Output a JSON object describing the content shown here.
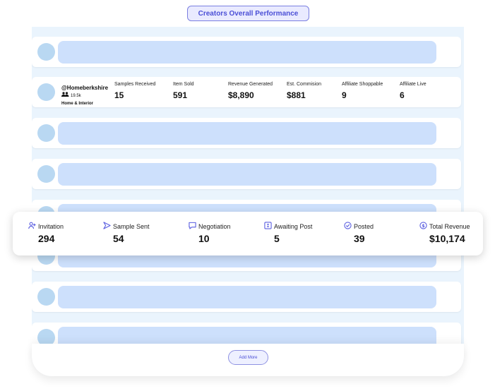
{
  "header": {
    "title": "Creators Overall Performance"
  },
  "creator": {
    "handle": "@Homeberkshire",
    "followers": "19.5k",
    "category": "Home & Interior"
  },
  "metrics": [
    {
      "label": "Samples Received",
      "value": "15"
    },
    {
      "label": "Item Sold",
      "value": "591"
    },
    {
      "label": "Revenue Generated",
      "value": "$8,890"
    },
    {
      "label": "Est. Commision",
      "value": "$881"
    },
    {
      "label": "Affiliate Shoppable",
      "value": "9"
    },
    {
      "label": "Affiliate Live",
      "value": "6"
    }
  ],
  "stats": [
    {
      "label": "Invitation",
      "value": "294",
      "icon": "user-plus-icon",
      "color": "#5b5fe0"
    },
    {
      "label": "Sample Sent",
      "value": "54",
      "icon": "send-icon",
      "color": "#5b5fe0"
    },
    {
      "label": "Negotiation",
      "value": "10",
      "icon": "chat-icon",
      "color": "#5b5fe0"
    },
    {
      "label": "Awaiting Post",
      "value": "5",
      "icon": "hourglass-box-icon",
      "color": "#5b5fe0"
    },
    {
      "label": "Posted",
      "value": "39",
      "icon": "check-circle-icon",
      "color": "#5b5fe0"
    },
    {
      "label": "Total Revenue",
      "value": "$10,174",
      "icon": "dollar-circle-icon",
      "color": "#5b5fe0"
    }
  ],
  "footer": {
    "add_more_label": "Add More"
  },
  "colors": {
    "accent": "#5b5fe0",
    "placeholder_bar": "#cde0fc",
    "avatar": "#b9d8f2",
    "panel": "#eaf4fd"
  }
}
